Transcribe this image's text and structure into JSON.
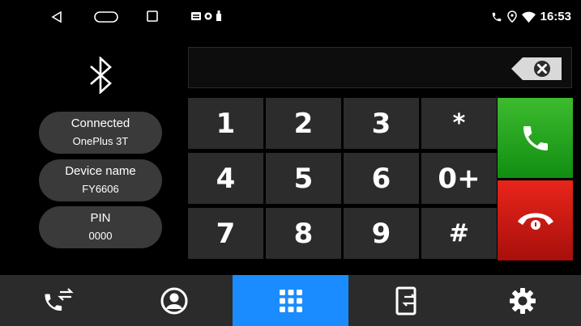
{
  "status_bar": {
    "time": "16:53",
    "nav_icons": [
      "back-icon",
      "home-icon",
      "recents-icon"
    ],
    "notification_icons": [
      "notification-icon",
      "record-icon",
      "usb-icon"
    ],
    "status_icons": [
      "phone-icon",
      "location-icon",
      "wifi-icon"
    ]
  },
  "device_info": {
    "connected_label": "Connected",
    "connected_value": "OnePlus 3T",
    "device_name_label": "Device name",
    "device_name_value": "FY6606",
    "pin_label": "PIN",
    "pin_value": "0000"
  },
  "dialer": {
    "display_value": "",
    "keys": [
      "1",
      "2",
      "3",
      "*",
      "4",
      "5",
      "6",
      "0+",
      "7",
      "8",
      "9",
      "#"
    ]
  },
  "bottom_tabs": [
    {
      "icon": "call-log-icon",
      "active": false
    },
    {
      "icon": "contacts-icon",
      "active": false
    },
    {
      "icon": "dialpad-icon",
      "active": true
    },
    {
      "icon": "phone-transfer-icon",
      "active": false
    },
    {
      "icon": "settings-icon",
      "active": false
    }
  ],
  "colors": {
    "accent": "#1a8cff",
    "call": "#28a521",
    "hangup": "#d11b14",
    "key_bg": "#2c2c2c",
    "panel_bg": "#3a3a3a"
  }
}
